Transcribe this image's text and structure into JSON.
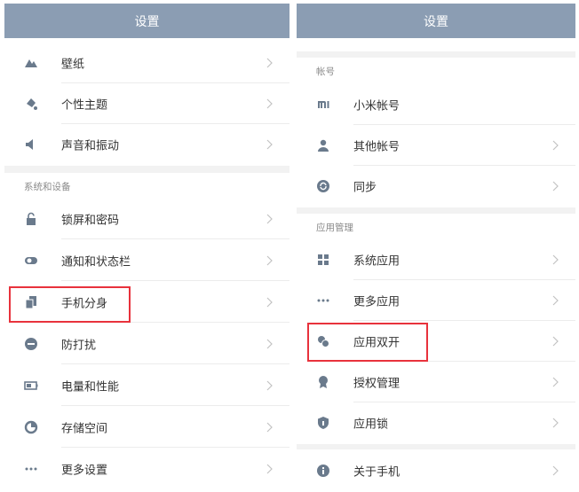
{
  "left": {
    "title": "设置",
    "top_items": [
      {
        "label": "壁纸",
        "icon": "wallpaper-icon"
      },
      {
        "label": "个性主题",
        "icon": "theme-icon"
      },
      {
        "label": "声音和振动",
        "icon": "sound-icon"
      }
    ],
    "section": "系统和设备",
    "system_items": [
      {
        "label": "锁屏和密码",
        "icon": "lock-icon"
      },
      {
        "label": "通知和状态栏",
        "icon": "toggle-icon"
      },
      {
        "label": "手机分身",
        "icon": "phone-clone-icon"
      },
      {
        "label": "防打扰",
        "icon": "do-not-disturb-icon"
      },
      {
        "label": "电量和性能",
        "icon": "battery-icon"
      },
      {
        "label": "存储空间",
        "icon": "storage-icon"
      },
      {
        "label": "更多设置",
        "icon": "more-icon"
      }
    ]
  },
  "right": {
    "title": "设置",
    "account_section": "帐号",
    "account_items": [
      {
        "label": "小米帐号",
        "icon": "mi-logo-icon"
      },
      {
        "label": "其他帐号",
        "icon": "person-icon"
      },
      {
        "label": "同步",
        "icon": "sync-icon"
      }
    ],
    "app_section": "应用管理",
    "app_items": [
      {
        "label": "系统应用",
        "icon": "grid-icon"
      },
      {
        "label": "更多应用",
        "icon": "more-icon"
      },
      {
        "label": "应用双开",
        "icon": "dual-app-icon"
      },
      {
        "label": "授权管理",
        "icon": "badge-icon"
      },
      {
        "label": "应用锁",
        "icon": "shield-icon"
      }
    ],
    "bottom_items": [
      {
        "label": "关于手机",
        "icon": "info-icon"
      }
    ]
  },
  "colors": {
    "titlebar": "#8b9db3",
    "icon": "#6a7a8c",
    "highlight": "#e8323c"
  }
}
